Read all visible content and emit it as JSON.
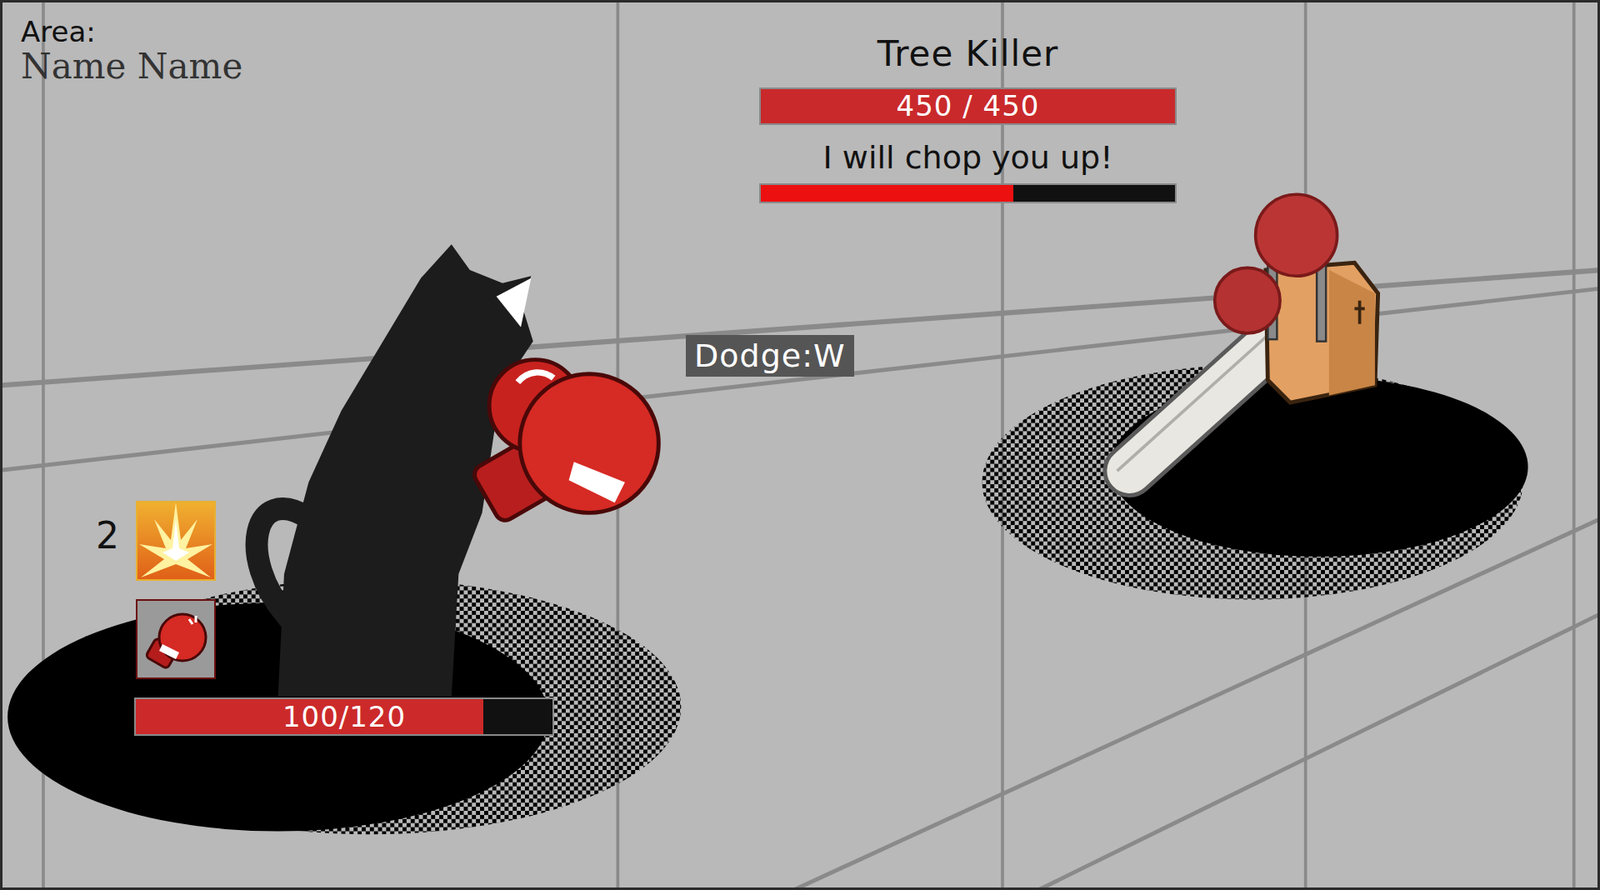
{
  "area": {
    "label": "Area:",
    "name": "Name Name"
  },
  "boss": {
    "name": "Tree Killer",
    "hp": "450 / 450",
    "hp_level": 1.0,
    "taunt": "I will chop you up!",
    "charge_level": 0.61
  },
  "prompt": {
    "text": "Dodge:W"
  },
  "player": {
    "hp": "100/120",
    "hp_level": 0.833,
    "effects": [
      {
        "kind": "burst",
        "count": "2"
      },
      {
        "kind": "glove",
        "count": null
      }
    ]
  }
}
